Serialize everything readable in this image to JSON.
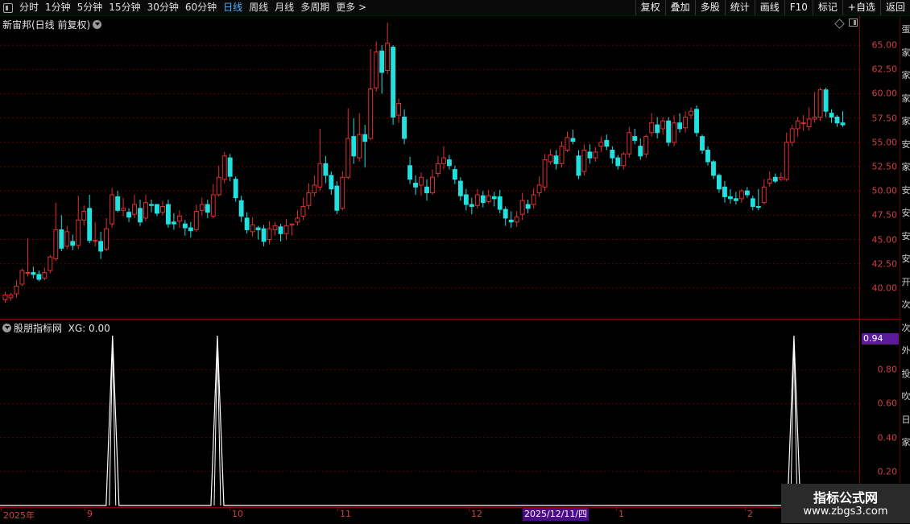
{
  "toolbar": {
    "left_items": [
      "分时",
      "1分钟",
      "5分钟",
      "15分钟",
      "30分钟",
      "60分钟",
      "日线",
      "周线",
      "月线",
      "多周期",
      "更多 >"
    ],
    "active": "日线",
    "right_items": [
      "复权",
      "叠加",
      "多股",
      "统计",
      "画线",
      "F10",
      "标记",
      "+自选",
      "返回"
    ]
  },
  "main": {
    "title": "新宙邦(日线 前复权)",
    "price_ticks": [
      "65.00",
      "62.50",
      "60.00",
      "57.50",
      "55.00",
      "52.50",
      "50.00",
      "47.50",
      "45.00",
      "42.50",
      "40.00"
    ],
    "grid_color": "#6a0000",
    "up_color": "#e03030",
    "down_color": "#20e0e0"
  },
  "indicator": {
    "title": "股朋指标网",
    "value_label": "XG: 0.00",
    "badge": "0.94",
    "ticks": [
      "0.80",
      "0.60",
      "0.40",
      "0.20"
    ]
  },
  "date_axis": {
    "labels": [
      "2025年",
      "9",
      "10",
      "11",
      "12",
      "1",
      "2"
    ],
    "highlight": "2025/12/11/四"
  },
  "right_strip_chars": [
    "蛋",
    "家",
    "家",
    "家",
    "家",
    "安",
    "家",
    "安",
    "安",
    "安",
    "安",
    "开",
    "次",
    "次",
    "外",
    "投",
    "吹",
    "日",
    "家"
  ],
  "watermark": {
    "title": "指标公式网",
    "url": "www.zbgs3.com"
  },
  "chart_data": {
    "type": "candlestick",
    "ylim": [
      38.0,
      67.0
    ],
    "candles": [
      [
        38.8,
        39.3,
        38.5,
        39.6
      ],
      [
        39.0,
        39.3,
        38.7,
        39.5
      ],
      [
        39.4,
        40.2,
        39.0,
        40.8
      ],
      [
        40.4,
        41.8,
        40.2,
        42.0
      ],
      [
        41.6,
        41.6,
        41.2,
        45.1
      ],
      [
        41.6,
        41.4,
        41.0,
        42.2
      ],
      [
        41.4,
        40.9,
        40.7,
        41.8
      ],
      [
        41.0,
        41.6,
        40.8,
        42.1
      ],
      [
        41.8,
        43.2,
        41.5,
        43.4
      ],
      [
        43.0,
        46.0,
        42.8,
        48.8
      ],
      [
        46.0,
        44.1,
        43.8,
        47.5
      ],
      [
        44.3,
        45.8,
        44.0,
        46.4
      ],
      [
        44.8,
        44.4,
        43.9,
        45.5
      ],
      [
        44.4,
        47.0,
        44.0,
        49.5
      ],
      [
        47.0,
        47.9,
        46.4,
        48.5
      ],
      [
        48.2,
        44.9,
        44.6,
        49.6
      ],
      [
        44.9,
        44.9,
        44.3,
        46.8
      ],
      [
        44.8,
        43.8,
        43.0,
        45.8
      ],
      [
        44.0,
        46.1,
        43.8,
        47.2
      ],
      [
        46.6,
        49.6,
        46.2,
        50.3
      ],
      [
        49.4,
        48.0,
        47.8,
        50.0
      ],
      [
        48.0,
        48.2,
        47.4,
        49.3
      ],
      [
        47.8,
        47.3,
        46.8,
        48.2
      ],
      [
        47.6,
        48.6,
        47.2,
        49.6
      ],
      [
        48.2,
        46.8,
        46.4,
        49.1
      ],
      [
        47.2,
        48.8,
        46.9,
        49.6
      ],
      [
        48.6,
        48.5,
        47.8,
        49.1
      ],
      [
        48.6,
        47.7,
        47.4,
        48.3
      ],
      [
        47.8,
        48.4,
        47.5,
        49.0
      ],
      [
        48.6,
        46.6,
        46.2,
        49.1
      ],
      [
        46.8,
        46.6,
        46.0,
        47.7
      ],
      [
        46.9,
        47.4,
        46.2,
        48.0
      ],
      [
        46.6,
        46.2,
        45.4,
        47.0
      ],
      [
        46.2,
        45.9,
        45.2,
        46.8
      ],
      [
        46.0,
        47.9,
        45.8,
        48.6
      ],
      [
        48.0,
        48.6,
        47.5,
        49.3
      ],
      [
        48.6,
        47.8,
        47.2,
        49.1
      ],
      [
        47.4,
        49.6,
        47.2,
        50.7
      ],
      [
        49.6,
        51.4,
        49.4,
        52.6
      ],
      [
        51.2,
        53.6,
        50.8,
        54.0
      ],
      [
        53.4,
        51.5,
        51.0,
        53.8
      ],
      [
        51.2,
        49.3,
        48.9,
        51.5
      ],
      [
        49.0,
        47.4,
        46.8,
        49.5
      ],
      [
        47.2,
        46.0,
        45.6,
        47.8
      ],
      [
        45.8,
        46.5,
        45.3,
        47.3
      ],
      [
        46.2,
        46.0,
        45.0,
        46.4
      ],
      [
        46.1,
        44.8,
        44.3,
        46.5
      ],
      [
        45.0,
        46.1,
        44.5,
        46.9
      ],
      [
        46.0,
        46.4,
        45.4,
        46.8
      ],
      [
        46.3,
        45.6,
        44.8,
        46.6
      ],
      [
        45.6,
        46.4,
        45.0,
        47.1
      ],
      [
        46.5,
        46.6,
        45.4,
        46.6
      ],
      [
        46.8,
        47.2,
        46.4,
        48.0
      ],
      [
        47.4,
        48.4,
        47.0,
        49.3
      ],
      [
        48.5,
        49.8,
        48.1,
        50.8
      ],
      [
        49.8,
        50.6,
        49.4,
        51.6
      ],
      [
        50.4,
        52.8,
        50.0,
        56.4
      ],
      [
        52.8,
        51.6,
        50.8,
        53.6
      ],
      [
        51.6,
        50.2,
        49.6,
        52.0
      ],
      [
        50.5,
        48.0,
        47.6,
        51.0
      ],
      [
        48.2,
        51.4,
        48.0,
        52.0
      ],
      [
        51.4,
        55.4,
        51.2,
        58.5
      ],
      [
        55.6,
        53.6,
        52.8,
        57.5
      ],
      [
        53.4,
        55.8,
        53.0,
        58.0
      ],
      [
        55.8,
        55.1,
        52.4,
        56.8
      ],
      [
        55.4,
        60.5,
        55.2,
        64.6
      ],
      [
        60.6,
        64.3,
        60.2,
        65.4
      ],
      [
        64.4,
        62.2,
        60.0,
        65.0
      ],
      [
        62.4,
        65.2,
        62.0,
        67.3
      ],
      [
        64.8,
        57.6,
        56.8,
        65.0
      ],
      [
        57.8,
        59.0,
        57.0,
        59.5
      ],
      [
        57.6,
        55.4,
        54.8,
        58.4
      ],
      [
        52.6,
        51.2,
        50.7,
        53.5
      ],
      [
        50.8,
        50.4,
        49.6,
        51.6
      ],
      [
        50.6,
        51.4,
        49.5,
        51.9
      ],
      [
        50.4,
        49.8,
        49.0,
        51.2
      ],
      [
        49.8,
        51.4,
        49.6,
        52.2
      ],
      [
        51.8,
        52.8,
        51.4,
        53.6
      ],
      [
        52.8,
        53.4,
        52.2,
        54.6
      ],
      [
        53.2,
        52.6,
        52.2,
        53.7
      ],
      [
        52.2,
        51.2,
        50.7,
        52.6
      ],
      [
        51.0,
        49.5,
        49.0,
        51.4
      ],
      [
        49.6,
        48.6,
        48.0,
        50.2
      ],
      [
        48.6,
        48.4,
        47.6,
        49.3
      ],
      [
        48.5,
        49.6,
        48.2,
        50.2
      ],
      [
        49.5,
        48.8,
        48.3,
        50.0
      ],
      [
        48.9,
        49.5,
        48.7,
        50.1
      ],
      [
        49.4,
        49.2,
        48.4,
        49.9
      ],
      [
        49.4,
        48.1,
        47.7,
        50.1
      ],
      [
        48.1,
        47.2,
        46.4,
        48.4
      ],
      [
        47.0,
        46.8,
        46.2,
        47.9
      ],
      [
        46.8,
        47.3,
        46.3,
        47.9
      ],
      [
        47.6,
        49.0,
        47.0,
        49.8
      ],
      [
        48.6,
        48.2,
        47.7,
        49.1
      ],
      [
        48.6,
        49.6,
        48.2,
        50.3
      ],
      [
        49.8,
        50.6,
        49.4,
        51.5
      ],
      [
        50.4,
        53.2,
        50.0,
        53.8
      ],
      [
        53.0,
        53.7,
        52.7,
        54.3
      ],
      [
        53.6,
        52.8,
        52.2,
        54.2
      ],
      [
        52.8,
        54.6,
        52.4,
        55.1
      ],
      [
        54.2,
        55.5,
        54.0,
        56.1
      ],
      [
        55.4,
        55.1,
        54.8,
        56.3
      ],
      [
        53.6,
        51.6,
        51.2,
        54.2
      ],
      [
        52.0,
        54.2,
        51.6,
        54.8
      ],
      [
        54.0,
        53.4,
        52.8,
        54.8
      ],
      [
        53.4,
        54.0,
        53.0,
        54.5
      ],
      [
        54.6,
        55.0,
        54.0,
        55.6
      ],
      [
        55.2,
        54.6,
        54.2,
        55.8
      ],
      [
        54.2,
        53.4,
        52.8,
        54.6
      ],
      [
        53.4,
        52.6,
        52.2,
        53.7
      ],
      [
        52.6,
        53.8,
        52.2,
        54.0
      ],
      [
        53.8,
        56.0,
        53.4,
        56.6
      ],
      [
        55.6,
        55.2,
        54.8,
        56.4
      ],
      [
        54.6,
        53.6,
        53.2,
        55.4
      ],
      [
        53.8,
        55.6,
        53.4,
        55.8
      ],
      [
        56.0,
        57.0,
        55.6,
        58.0
      ],
      [
        56.8,
        56.0,
        55.4,
        57.6
      ],
      [
        56.4,
        57.2,
        55.8,
        57.6
      ],
      [
        57.2,
        55.0,
        54.6,
        57.6
      ],
      [
        55.0,
        57.0,
        54.6,
        57.8
      ],
      [
        57.0,
        56.4,
        56.0,
        58.0
      ],
      [
        56.5,
        57.6,
        56.0,
        58.2
      ],
      [
        57.8,
        58.2,
        57.4,
        58.6
      ],
      [
        58.4,
        56.0,
        55.6,
        58.8
      ],
      [
        55.6,
        54.2,
        53.8,
        55.8
      ],
      [
        54.2,
        53.0,
        52.6,
        54.6
      ],
      [
        53.0,
        51.6,
        51.2,
        53.2
      ],
      [
        51.6,
        50.2,
        49.8,
        51.8
      ],
      [
        50.4,
        49.4,
        48.8,
        51.0
      ],
      [
        49.4,
        49.2,
        48.7,
        50.2
      ],
      [
        49.2,
        49.0,
        48.6,
        49.9
      ],
      [
        49.2,
        50.0,
        48.8,
        50.2
      ],
      [
        50.0,
        49.6,
        49.3,
        50.4
      ],
      [
        49.2,
        48.4,
        48.0,
        49.5
      ],
      [
        48.4,
        48.3,
        48.0,
        50.2
      ],
      [
        48.8,
        50.4,
        48.6,
        51.2
      ],
      [
        50.8,
        51.2,
        50.4,
        52.0
      ],
      [
        51.4,
        51.0,
        50.8,
        51.8
      ],
      [
        51.2,
        51.4,
        51.0,
        51.9
      ],
      [
        51.2,
        55.0,
        51.0,
        56.0
      ],
      [
        55.0,
        56.4,
        54.6,
        56.8
      ],
      [
        56.4,
        57.2,
        55.6,
        57.6
      ],
      [
        57.0,
        57.0,
        56.2,
        57.8
      ],
      [
        56.6,
        57.4,
        56.2,
        58.6
      ],
      [
        57.4,
        57.6,
        57.0,
        60.2
      ],
      [
        57.6,
        60.4,
        57.2,
        60.6
      ],
      [
        60.4,
        58.2,
        57.6,
        60.6
      ],
      [
        58.0,
        57.6,
        57.0,
        58.4
      ],
      [
        57.6,
        57.0,
        56.6,
        57.8
      ],
      [
        57.0,
        56.8,
        56.6,
        58.2
      ]
    ],
    "indicator_peaks_x_fraction": [
      0.131,
      0.253,
      0.924
    ],
    "indicator_ylim": [
      0.0,
      1.0
    ]
  }
}
